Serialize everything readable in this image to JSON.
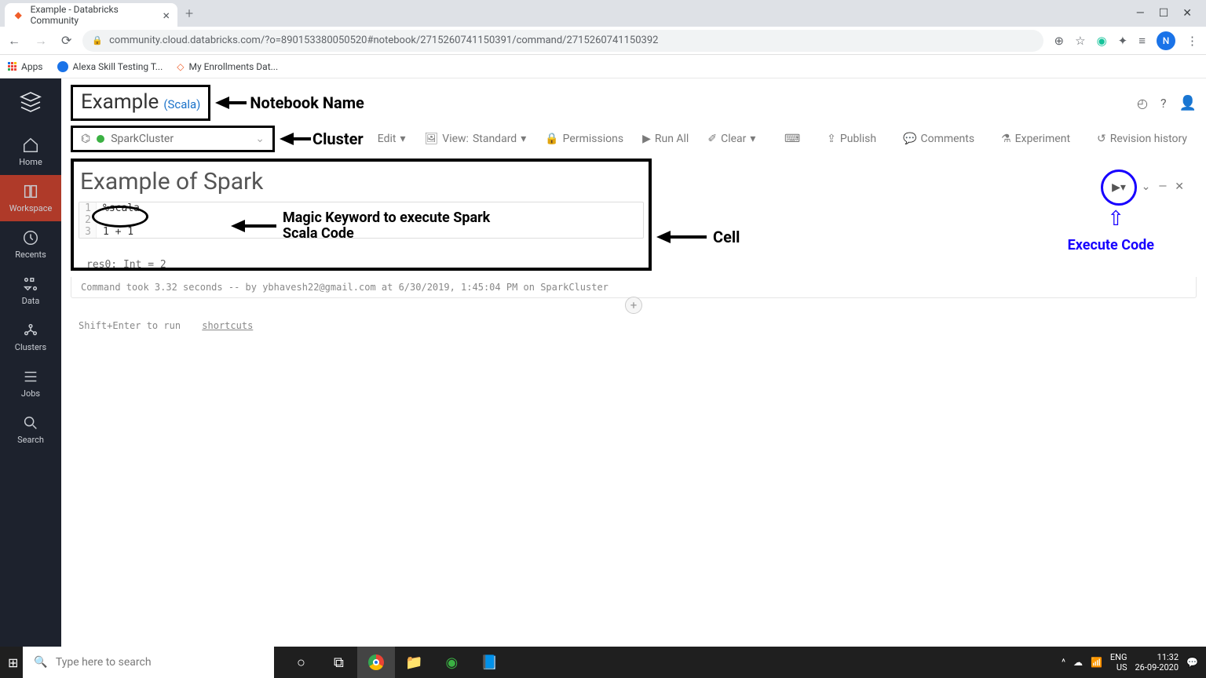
{
  "browser": {
    "tab_title": "Example - Databricks Community",
    "url": "community.cloud.databricks.com/?o=890153380050520#notebook/2715260741150391/command/2715260741150392",
    "bookmarks": {
      "apps": "Apps",
      "alexa": "Alexa Skill Testing T...",
      "enroll": "My Enrollments Dat..."
    },
    "avatar_letter": "N"
  },
  "sidebar": {
    "items": [
      {
        "label": "Home"
      },
      {
        "label": "Workspace"
      },
      {
        "label": "Recents"
      },
      {
        "label": "Data"
      },
      {
        "label": "Clusters"
      },
      {
        "label": "Jobs"
      },
      {
        "label": "Search"
      }
    ]
  },
  "notebook": {
    "name": "Example",
    "language": "(Scala)",
    "cluster": "SparkCluster",
    "toolbar": {
      "edit": "Edit",
      "view_prefix": "View:",
      "view_value": "Standard",
      "permissions": "Permissions",
      "run_all": "Run All",
      "clear": "Clear",
      "publish": "Publish",
      "comments": "Comments",
      "experiment": "Experiment",
      "revision": "Revision history"
    }
  },
  "annotations": {
    "notebook_name": "Notebook Name",
    "cluster": "Cluster",
    "magic": "Magic Keyword to execute Spark Scala Code",
    "cell": "Cell",
    "execute": "Execute Code"
  },
  "cell": {
    "heading": "Example of Spark",
    "lines": [
      {
        "n": "1",
        "code": "%scala"
      },
      {
        "n": "2",
        "code": ""
      },
      {
        "n": "3",
        "code": "1 +  1"
      }
    ],
    "output": "res0: Int = 2",
    "result_meta": "Command took 3.32 seconds -- by ybhavesh22@gmail.com at 6/30/2019, 1:45:04 PM on SparkCluster",
    "hint": "Shift+Enter to run",
    "shortcuts": "shortcuts"
  },
  "taskbar": {
    "search_placeholder": "Type here to search",
    "lang": "ENG",
    "locale": "US",
    "time": "11:32",
    "date": "26-09-2020"
  }
}
